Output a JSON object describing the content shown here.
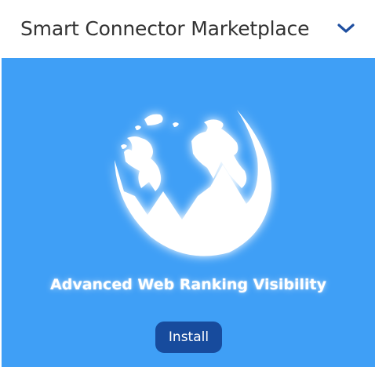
{
  "header": {
    "title": "Smart Connector Marketplace",
    "dropdown_icon": "chevron-down-icon"
  },
  "connector": {
    "name": "Advanced Web Ranking Visibility",
    "logo_icon": "globe-mountains-logo",
    "install_label": "Install"
  },
  "colors": {
    "card_background": "#3f9ff6",
    "button_background": "#174b9d",
    "chevron": "#1f4fa0",
    "header_text": "#333333"
  }
}
